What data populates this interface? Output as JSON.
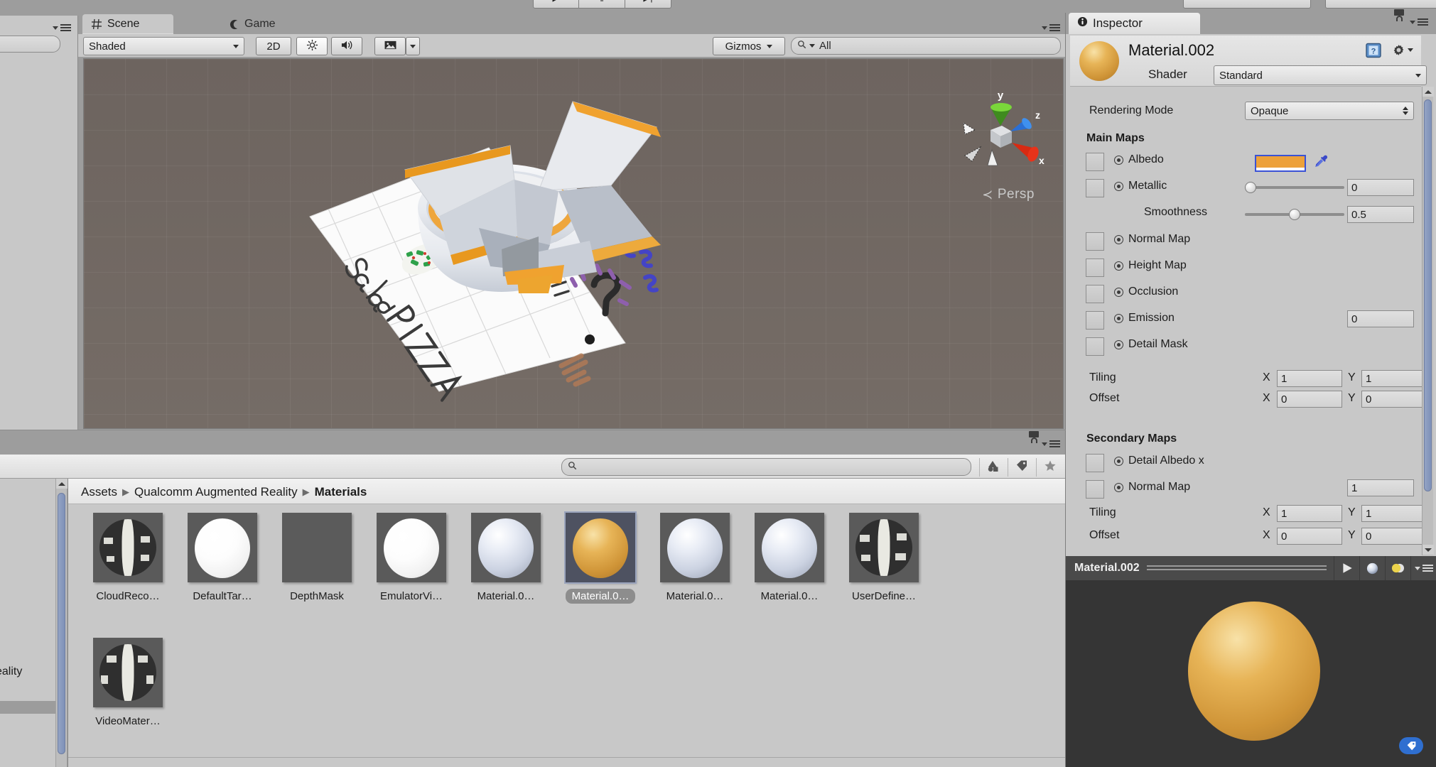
{
  "toolbar": {
    "play_label": "▶",
    "pause_label": "‖",
    "step_label": "▶|"
  },
  "scene_tabs": [
    {
      "label": "Scene",
      "icon": "grid-icon",
      "active": true
    },
    {
      "label": "Game",
      "icon": "gamepad-icon",
      "active": false
    }
  ],
  "scene_toolbar": {
    "draw_mode": "Shaded",
    "two_d_label": "2D",
    "lighting_icon": "sun-icon",
    "audio_icon": "speaker-icon",
    "fx_icon": "image-icon",
    "gizmos_label": "Gizmos",
    "search_placeholder": "All",
    "search_value": "All",
    "search_icon": "search-icon"
  },
  "scene_view": {
    "projection_label": "Persp",
    "axis_labels": {
      "x": "x",
      "y": "y",
      "z": "z"
    },
    "content_note": "Salad / PIZZA handwritten AR target with bowl of pizza slices",
    "drawn_words": [
      "Salad",
      "PIZZA"
    ]
  },
  "project": {
    "search_value": "",
    "search_placeholder": "",
    "filter_icons": [
      "type-filter-icon",
      "label-filter-icon",
      "favorite-filter-icon"
    ],
    "breadcrumb": [
      "Assets",
      "Qualcomm Augmented Reality",
      "Materials"
    ],
    "tree_partial_item": "eality",
    "assets": [
      {
        "name": "CloudReco…",
        "thumb": "vuforia",
        "selected": false
      },
      {
        "name": "DefaultTar…",
        "thumb": "white",
        "selected": false
      },
      {
        "name": "DepthMask",
        "thumb": "flat",
        "selected": false
      },
      {
        "name": "EmulatorVi…",
        "thumb": "white",
        "selected": false
      },
      {
        "name": "Material.0…",
        "thumb": "grey",
        "selected": false
      },
      {
        "name": "Material.0…",
        "thumb": "gold",
        "selected": true
      },
      {
        "name": "Material.0…",
        "thumb": "grey",
        "selected": false
      },
      {
        "name": "Material.0…",
        "thumb": "grey",
        "selected": false
      },
      {
        "name": "UserDefine…",
        "thumb": "vuforia",
        "selected": false
      },
      {
        "name": "VideoMater…",
        "thumb": "vuforia",
        "selected": false
      }
    ]
  },
  "inspector": {
    "tab_label": "Inspector",
    "tab_icon": "info-icon",
    "lock_icon": "lock-icon",
    "menu_icon": "hamburger-icon",
    "material_name": "Material.002",
    "help_icon": "help-book-icon",
    "settings_icon": "gear-icon",
    "shader_label": "Shader",
    "shader_value": "Standard",
    "rendering_mode_label": "Rendering Mode",
    "rendering_mode_value": "Opaque",
    "main_maps_title": "Main Maps",
    "secondary_maps_title": "Secondary Maps",
    "albedo_color": "#eda13a",
    "eyedropper_icon": "eyedropper-icon",
    "main_maps": [
      {
        "label": "Albedo",
        "type": "color",
        "value": "#eda13a"
      },
      {
        "label": "Metallic",
        "type": "slider",
        "value": "0",
        "fraction": 0.0
      },
      {
        "label": "Smoothness",
        "type": "slider",
        "value": "0.5",
        "fraction": 0.5,
        "indent": true
      },
      {
        "label": "Normal Map",
        "type": "slot"
      },
      {
        "label": "Height Map",
        "type": "slot"
      },
      {
        "label": "Occlusion",
        "type": "slot"
      },
      {
        "label": "Emission",
        "type": "slot",
        "value": "0"
      },
      {
        "label": "Detail Mask",
        "type": "slot"
      }
    ],
    "main_tiling": {
      "label": "Tiling",
      "x_label": "X",
      "x": "1",
      "y_label": "Y",
      "y": "1"
    },
    "main_offset": {
      "label": "Offset",
      "x_label": "X",
      "x": "0",
      "y_label": "Y",
      "y": "0"
    },
    "secondary_maps": [
      {
        "label": "Detail Albedo x",
        "type": "slot"
      },
      {
        "label": "Normal Map",
        "type": "slot",
        "value": "1"
      }
    ],
    "secondary_tiling": {
      "label": "Tiling",
      "x_label": "X",
      "x": "1",
      "y_label": "Y",
      "y": "1"
    },
    "secondary_offset": {
      "label": "Offset",
      "x_label": "X",
      "x": "0",
      "y_label": "Y",
      "y": "0"
    }
  },
  "preview": {
    "title": "Material.002",
    "play_icon": "play-icon",
    "sphere_icon": "sphere-icon",
    "lighting_icon": "light-toggle-icon",
    "menu_icon": "hamburger-icon",
    "tag_badge_icon": "tag-icon"
  }
}
